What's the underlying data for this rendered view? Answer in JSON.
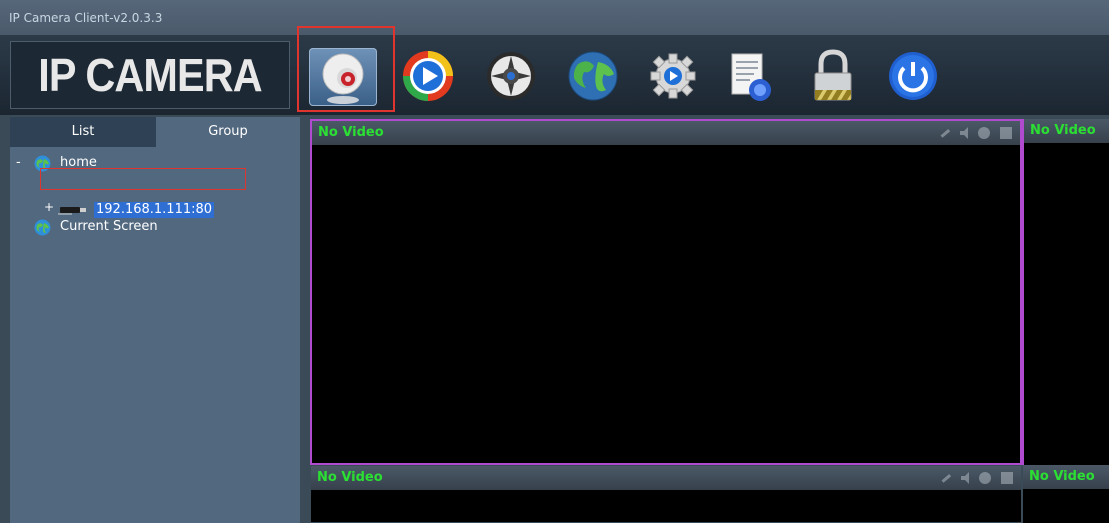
{
  "window": {
    "title": "IP Camera Client-v2.0.3.3"
  },
  "logo": {
    "text": "IP CAMERA"
  },
  "toolbar": {
    "buttons": [
      {
        "name": "camera",
        "icon": "webcam-icon",
        "selected": true
      },
      {
        "name": "playback",
        "icon": "play-circle-icon"
      },
      {
        "name": "ptz",
        "icon": "steering-wheel-icon"
      },
      {
        "name": "network",
        "icon": "globe-icon"
      },
      {
        "name": "settings",
        "icon": "gear-icon"
      },
      {
        "name": "log",
        "icon": "document-icon"
      },
      {
        "name": "lock",
        "icon": "lock-icon"
      },
      {
        "name": "exit",
        "icon": "power-icon"
      }
    ]
  },
  "sidebar": {
    "tabs": {
      "list": "List",
      "group": "Group"
    },
    "tree": {
      "root_expander": "-",
      "root_label": "home",
      "device_expander": "+",
      "device_label": "192.168.1.111:80",
      "current_screen": "Current Screen"
    }
  },
  "video": {
    "pane_title": "No Video"
  },
  "colors": {
    "accent_highlight": "#e0342f",
    "video_label": "#2be033",
    "pane_border_active": "#b04bd0"
  }
}
